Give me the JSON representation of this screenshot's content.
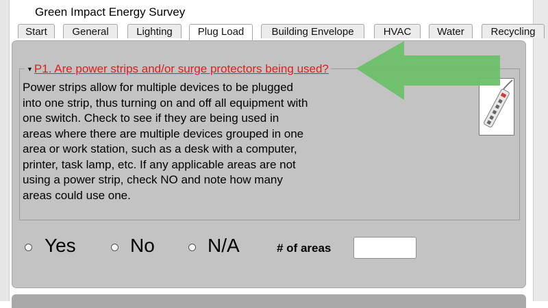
{
  "app": {
    "title": "Green Impact Energy Survey"
  },
  "tabs": [
    {
      "label": "Start"
    },
    {
      "label": "General"
    },
    {
      "label": "Lighting"
    },
    {
      "label": "Plug Load",
      "active": true
    },
    {
      "label": "Building Envelope"
    },
    {
      "label": "HVAC"
    },
    {
      "label": "Water"
    },
    {
      "label": "Recycling"
    }
  ],
  "question": {
    "title": "P1. Are power strips and/or surge protectors being used?",
    "description": "Power strips allow for multiple devices to be plugged into one strip, thus turning on and off all equipment with one switch. Check to see if they are being used in areas where there are multiple devices grouped in one area or work station, such as a desk with a computer, printer, task lamp, etc. If any applicable areas are not using a power strip, check NO and note how many areas could use one.",
    "image_icon": "power-strip-icon",
    "options": [
      {
        "label": "Yes"
      },
      {
        "label": "No"
      },
      {
        "label": "N/A"
      }
    ],
    "areas_label": "# of areas",
    "areas_value": ""
  },
  "colors": {
    "question_red": "#e01c1c",
    "panel_gray": "#c3c3c3",
    "arrow_green": "#6cc06a"
  }
}
